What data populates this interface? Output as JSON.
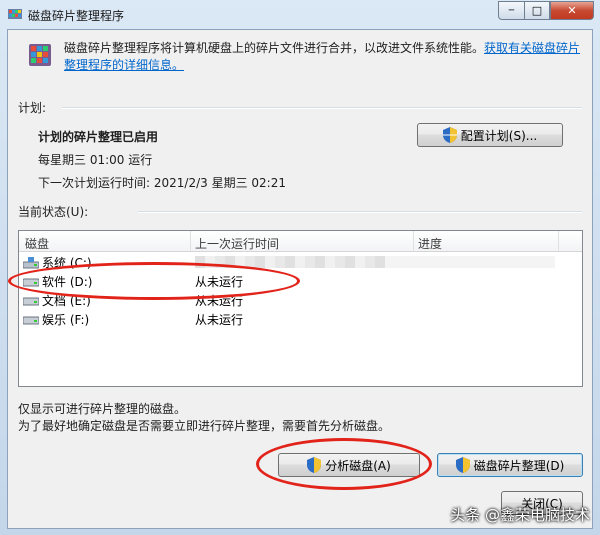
{
  "window": {
    "title": "磁盘碎片整理程序",
    "controls": {
      "minimize": "─",
      "maximize": "□",
      "close": "✕"
    }
  },
  "header": {
    "description": "磁盘碎片整理程序将计算机硬盘上的碎片文件进行合并，以改进文件系统性能。",
    "link": "获取有关磁盘碎片整理程序的详细信息。"
  },
  "schedule": {
    "section_label": "计划:",
    "status": "计划的碎片整理已启用",
    "run_time": "每星期三  01:00 运行",
    "next_run": "下一次计划运行时间: 2021/2/3 星期三 02:21",
    "configure_button": "配置计划(S)..."
  },
  "status": {
    "section_label": "当前状态(U):",
    "columns": [
      "磁盘",
      "上一次运行时间",
      "进度"
    ],
    "disks": [
      {
        "name": "系统 (C:)",
        "last_run": ""
      },
      {
        "name": "软件 (D:)",
        "last_run": "从未运行"
      },
      {
        "name": "文档 (E:)",
        "last_run": "从未运行"
      },
      {
        "name": "娱乐 (F:)",
        "last_run": "从未运行"
      }
    ]
  },
  "notes": {
    "line1": "仅显示可进行碎片整理的磁盘。",
    "line2": "为了最好地确定磁盘是否需要立即进行碎片整理，需要首先分析磁盘。"
  },
  "actions": {
    "analyze_button": "分析磁盘(A)",
    "defrag_button": "磁盘碎片整理(D)",
    "close_button": "关闭(C)"
  },
  "watermark": "头条 @鑫荣电脑技术",
  "colors": {
    "accent_link": "#0066cc",
    "annotation_red": "#e2231a",
    "window_frame": "#c9dcef"
  }
}
